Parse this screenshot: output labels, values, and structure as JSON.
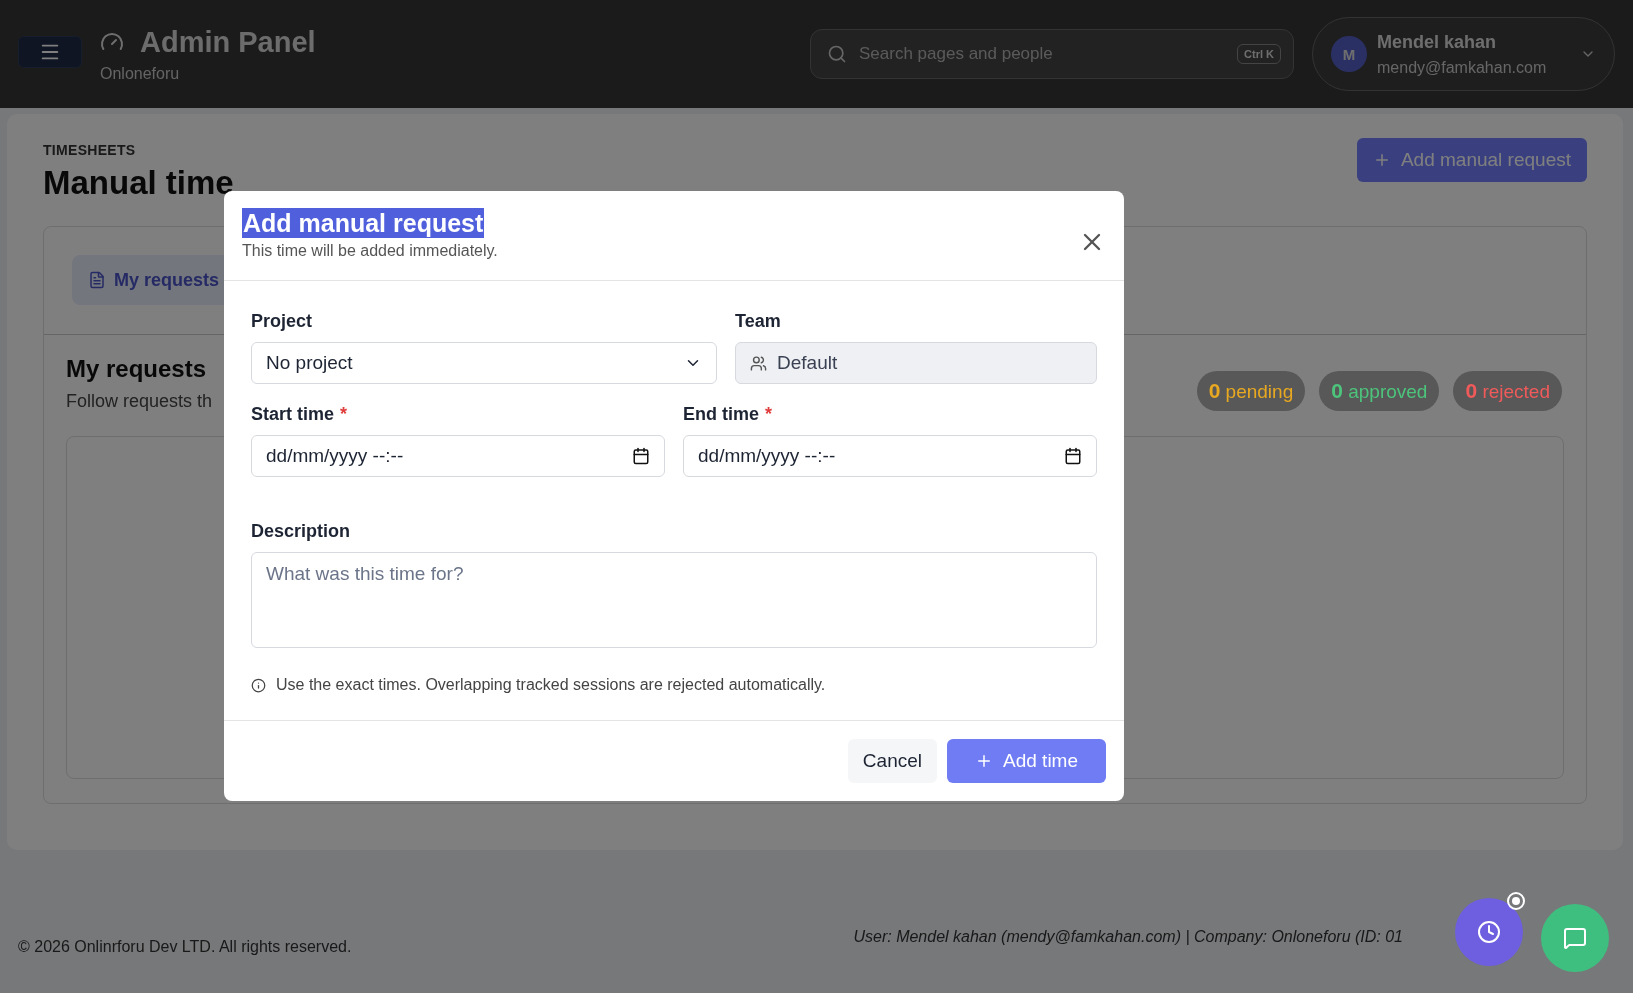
{
  "header": {
    "title": "Admin Panel",
    "subtitle": "Onloneforu",
    "search": {
      "placeholder": "Search pages and people",
      "shortcut": "Ctrl K"
    },
    "user": {
      "initial": "M",
      "name": "Mendel kahan",
      "email": "mendy@famkahan.com"
    }
  },
  "page": {
    "eyebrow": "TIMESHEETS",
    "title": "Manual time",
    "primary_button": "Add manual request",
    "tabs": [
      {
        "label": "My requests",
        "selected": true
      }
    ],
    "section": {
      "title": "My requests",
      "subtitle": "Follow requests th"
    },
    "stats": [
      {
        "count": "0",
        "label": "pending",
        "color": "#e8a820"
      },
      {
        "count": "0",
        "label": "approved",
        "color": "#4cc47c"
      },
      {
        "count": "0",
        "label": "rejected",
        "color": "#f05a5a"
      }
    ]
  },
  "footer": {
    "copyright": "© 2026 Onlinrforu Dev LTD. All rights reserved.",
    "info": "User: Mendel kahan (mendy@famkahan.com) | Company: Onloneforu (ID: 01"
  },
  "dialog": {
    "title": "Add manual request",
    "subtitle": "This time will be added immediately.",
    "project": {
      "label": "Project",
      "value": "No project"
    },
    "team": {
      "label": "Team",
      "value": "Default",
      "disabled": true
    },
    "start": {
      "label": "Start time",
      "required_mark": "*",
      "value": "dd/mm/yyyy --:--"
    },
    "end": {
      "label": "End time",
      "required_mark": "*",
      "value": "dd/mm/yyyy --:--"
    },
    "description": {
      "label": "Description",
      "placeholder": "What was this time for?"
    },
    "note": "Use the exact times. Overlapping tracked sessions are rejected automatically.",
    "buttons": {
      "cancel": "Cancel",
      "submit": "Add time"
    }
  }
}
